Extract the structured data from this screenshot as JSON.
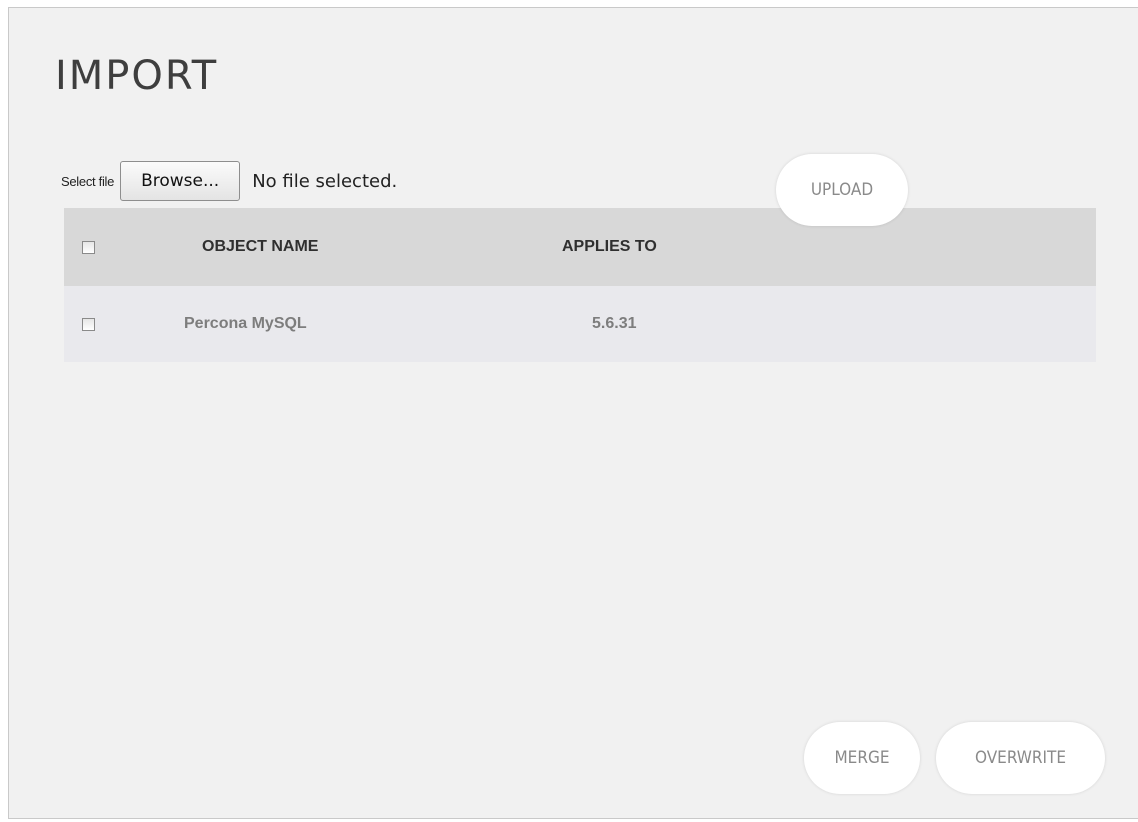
{
  "import_panel": {
    "title": "IMPORT",
    "file": {
      "label": "Select file",
      "browse_label": "Browse...",
      "status": "No file selected."
    },
    "upload_label": "UPLOAD",
    "table": {
      "columns": [
        "OBJECT NAME",
        "APPLIES TO"
      ],
      "rows": [
        {
          "checked": false,
          "object_name": "Percona MySQL",
          "applies_to": "5.6.31"
        }
      ]
    },
    "actions": {
      "merge_label": "MERGE",
      "overwrite_label": "OVERWRITE"
    },
    "colors": {
      "panel_bg": "#f1f1f1",
      "header_bg": "#d8d8d8",
      "row_bg": "#e9e9ed",
      "button_text": "#8a8a8a"
    }
  }
}
